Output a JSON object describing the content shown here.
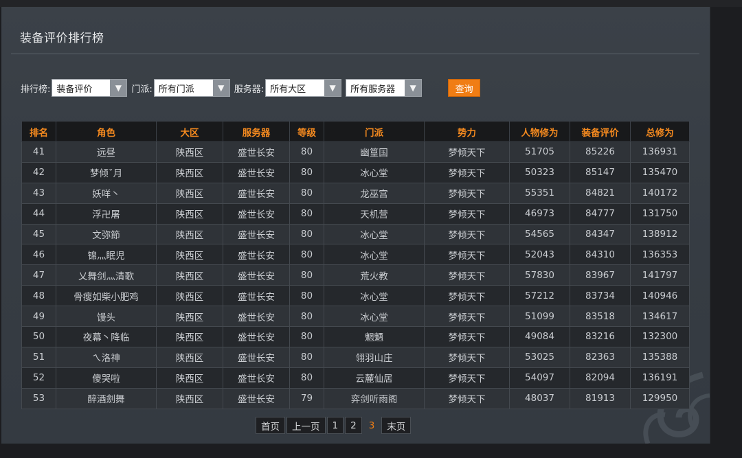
{
  "page": {
    "title": "装备评价排行榜"
  },
  "filters": {
    "ranking_label": "排行榜:",
    "ranking_value": "装备评价",
    "sect_label": "门派:",
    "sect_value": "所有门派",
    "server_label": "服务器:",
    "region_value": "所有大区",
    "server_value": "所有服务器",
    "query_button": "查询"
  },
  "table": {
    "headers": [
      "排名",
      "角色",
      "大区",
      "服务器",
      "等级",
      "门派",
      "势力",
      "人物修为",
      "装备评价",
      "总修为"
    ],
    "rows": [
      [
        "41",
        "远昼",
        "陕西区",
        "盛世长安",
        "80",
        "幽篁国",
        "梦倾天下",
        "51705",
        "85226",
        "136931"
      ],
      [
        "42",
        "梦倾ˇ月",
        "陕西区",
        "盛世长安",
        "80",
        "冰心堂",
        "梦倾天下",
        "50323",
        "85147",
        "135470"
      ],
      [
        "43",
        "妖咩丶",
        "陕西区",
        "盛世长安",
        "80",
        "龙巫宫",
        "梦倾天下",
        "55351",
        "84821",
        "140172"
      ],
      [
        "44",
        "浮卍屠",
        "陕西区",
        "盛世长安",
        "80",
        "天机营",
        "梦倾天下",
        "46973",
        "84777",
        "131750"
      ],
      [
        "45",
        "文弥節",
        "陕西区",
        "盛世长安",
        "80",
        "冰心堂",
        "梦倾天下",
        "54565",
        "84347",
        "138912"
      ],
      [
        "46",
        "锦灬眠児",
        "陕西区",
        "盛世长安",
        "80",
        "冰心堂",
        "梦倾天下",
        "52043",
        "84310",
        "136353"
      ],
      [
        "47",
        "乂舞剑灬清歌",
        "陕西区",
        "盛世长安",
        "80",
        "荒火教",
        "梦倾天下",
        "57830",
        "83967",
        "141797"
      ],
      [
        "48",
        "骨瘦如柴小肥鸡",
        "陕西区",
        "盛世长安",
        "80",
        "冰心堂",
        "梦倾天下",
        "57212",
        "83734",
        "140946"
      ],
      [
        "49",
        "馒头",
        "陕西区",
        "盛世长安",
        "80",
        "冰心堂",
        "梦倾天下",
        "51099",
        "83518",
        "134617"
      ],
      [
        "50",
        "夜幕丶降临",
        "陕西区",
        "盛世长安",
        "80",
        "魍魉",
        "梦倾天下",
        "49084",
        "83216",
        "132300"
      ],
      [
        "51",
        "ㄟ洛神",
        "陕西区",
        "盛世长安",
        "80",
        "翎羽山庄",
        "梦倾天下",
        "53025",
        "82363",
        "135388"
      ],
      [
        "52",
        "傻哭啦",
        "陕西区",
        "盛世长安",
        "80",
        "云麓仙居",
        "梦倾天下",
        "54097",
        "82094",
        "136191"
      ],
      [
        "53",
        "醉酒劍舞",
        "陕西区",
        "盛世长安",
        "79",
        "弈剑听雨阁",
        "梦倾天下",
        "48037",
        "81913",
        "129950"
      ]
    ]
  },
  "pagination": {
    "first": "首页",
    "prev": "上一页",
    "pages": [
      "1",
      "2",
      "3"
    ],
    "current": "3",
    "last": "末页"
  },
  "icons": {
    "dropdown_arrow": "▼"
  },
  "colors": {
    "accent": "#f07d14",
    "header_text": "#f58a1f"
  }
}
